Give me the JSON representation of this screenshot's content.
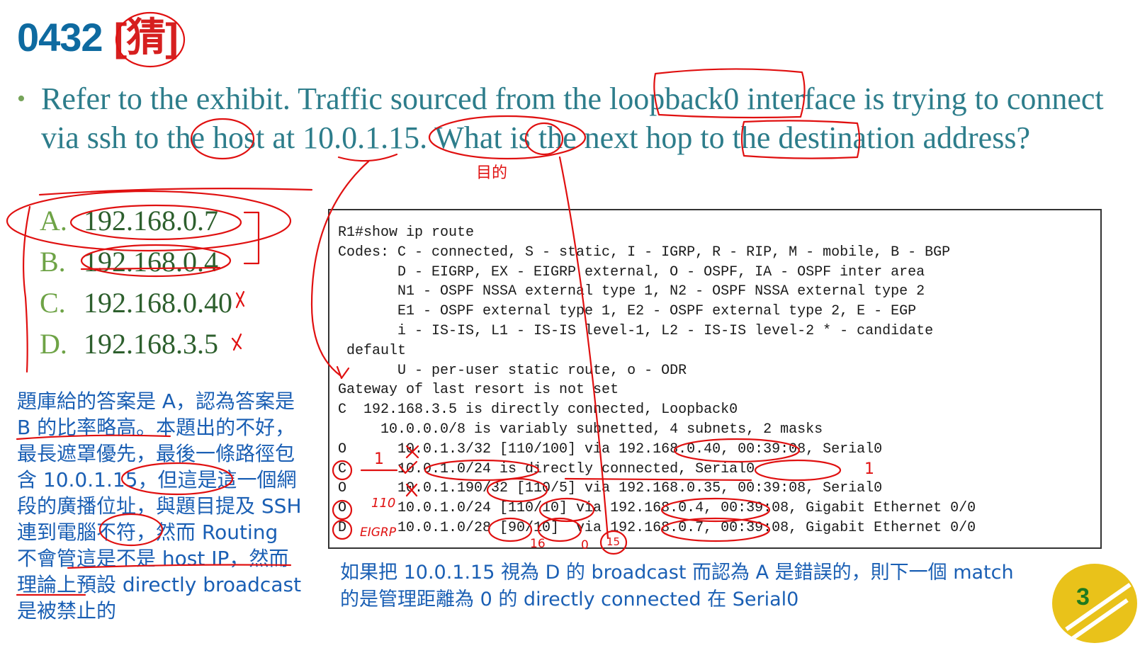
{
  "title": {
    "number": "0432",
    "tag": "[猜]"
  },
  "question": {
    "text": "Refer to the exhibit. Traffic sourced from the loopback0 interface is trying to connect via ssh to the host at 10.0.1.15. What is the next hop to the destination address?"
  },
  "options": [
    {
      "letter": "A.",
      "value": "192.168.0.7"
    },
    {
      "letter": "B.",
      "value": "192.168.0.4"
    },
    {
      "letter": "C.",
      "value": "192.168.0.40"
    },
    {
      "letter": "D.",
      "value": "192.168.3.5"
    }
  ],
  "exhibit": {
    "lines": [
      "R1#show ip route",
      "Codes: C - connected, S - static, I - IGRP, R - RIP, M - mobile, B - BGP",
      "       D - EIGRP, EX - EIGRP external, O - OSPF, IA - OSPF inter area",
      "       N1 - OSPF NSSA external type 1, N2 - OSPF NSSA external type 2",
      "       E1 - OSPF external type 1, E2 - OSPF external type 2, E - EGP",
      "       i - IS-IS, L1 - IS-IS level-1, L2 - IS-IS level-2 * - candidate",
      " default",
      "       U - per-user static route, o - ODR",
      "Gateway of last resort is not set",
      "C  192.168.3.5 is directly connected, Loopback0",
      "     10.0.0.0/8 is variably subnetted, 4 subnets, 2 masks",
      "O      10.0.1.3/32 [110/100] via 192.168.0.40, 00:39:08, Serial0",
      "C      10.0.1.0/24 is directly connected, Serial0",
      "O      10.0.1.190/32 [110/5] via 192.168.0.35, 00:39:08, Serial0",
      "O      10.0.1.0/24 [110/10] via 192.168.0.4, 00:39:08, Gigabit Ethernet 0/0",
      "D      10.0.1.0/28 [90/10]  via 192.168.0.7, 00:39:08, Gigabit Ethernet 0/0"
    ]
  },
  "note": "題庫給的答案是 A，認為答案是 B 的比率略高。本題出的不好，最長遮罩優先，最後一條路徑包含 10.0.1.15，但這是這一個網段的廣播位址，與題目提及 SSH 連到電腦不符，然而 Routing 不會管這是不是 host IP，然而理論上預設 directly broadcast 是被禁止的",
  "answer_note": "如果把 10.0.1.15 視為 D 的 broadcast 而認為 A 是錯誤的，則下一個 match 的是管理距離為 0 的 directly connected 在 Serial0",
  "annotations": {
    "cost_1a": "1",
    "cost_1b": "1",
    "ad_110": "110",
    "eigrp": "EIGRP",
    "bits_16": "16",
    "bits_0": "0",
    "bits_15": "15",
    "ad_label": "目的"
  },
  "page_number": "3",
  "colors": {
    "title": "#0e6aa0",
    "tag": "#d61f1f",
    "question": "#2d7d8b",
    "note": "#1a5fb4",
    "ink": "#e01010",
    "badge": "#e9c21a"
  }
}
